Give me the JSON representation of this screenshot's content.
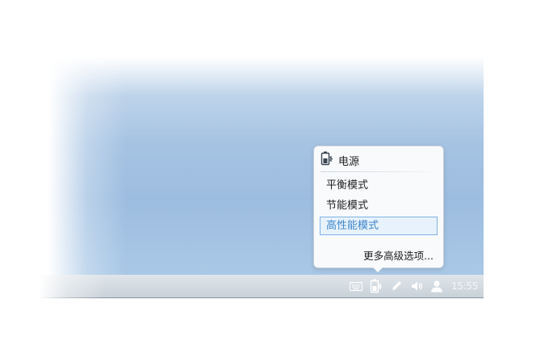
{
  "popup": {
    "title": "电源",
    "title_icon": "battery-plug-icon",
    "modes": [
      {
        "label": "平衡模式",
        "selected": false
      },
      {
        "label": "节能模式",
        "selected": false
      },
      {
        "label": "高性能模式",
        "selected": true
      }
    ],
    "more_options": "更多高级选项..."
  },
  "taskbar": {
    "tray_icons": [
      "keyboard-icon",
      "battery-plug-icon",
      "pen-icon",
      "speaker-icon",
      "user-icon"
    ],
    "clock": "15:55"
  },
  "colors": {
    "selected_text": "#3e86c9",
    "selected_border": "#7fb2e5",
    "selected_bg": "#e8f2fc",
    "wallpaper": "#a7c4e3"
  }
}
